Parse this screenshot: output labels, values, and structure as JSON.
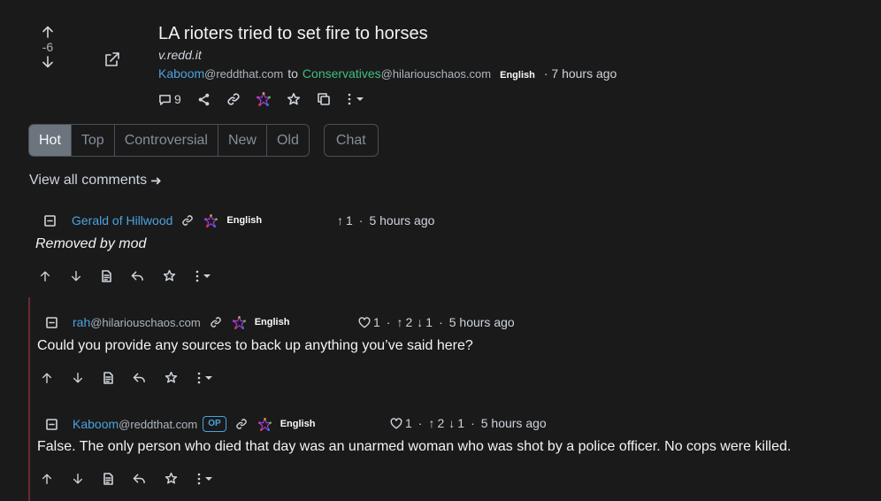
{
  "post": {
    "score": "-6",
    "title": "LA rioters tried to set fire to horses",
    "url": "v.redd.it",
    "author": "Kaboom",
    "author_domain": "@reddthat.com",
    "to_label": "to",
    "community": "Conservatives",
    "community_domain": "@hilariouschaos.com",
    "language": "English",
    "time": "· 7 hours ago",
    "comment_count": "9",
    "icons": [
      "arrow-up-icon",
      "arrow-down-icon",
      "external-link-icon",
      "comment-icon",
      "share-icon",
      "link-icon",
      "fediverse-icon",
      "star-icon",
      "copy-icon",
      "more-icon",
      "caret-down-icon"
    ]
  },
  "sort": {
    "tabs": [
      "Hot",
      "Top",
      "Controversial",
      "New",
      "Old"
    ],
    "active": "Hot",
    "chat_label": "Chat"
  },
  "view_all": {
    "label": "View all comments",
    "arrow": "➜"
  },
  "comments": [
    {
      "author": "Gerald of Hillwood",
      "domain": "",
      "language": "English",
      "score_up": "1",
      "time": "5 hours ago",
      "body": "Removed by mod"
    },
    {
      "author": "rah",
      "domain": "@hilariouschaos.com",
      "language": "English",
      "likes": "1",
      "up": "2",
      "down": "1",
      "time": "5 hours ago",
      "body": "Could you provide any sources to back up anything you’ve said here?"
    },
    {
      "author": "Kaboom",
      "domain": "@reddthat.com",
      "op_badge": "OP",
      "language": "English",
      "likes": "1",
      "up": "2",
      "down": "1",
      "time": "5 hours ago",
      "body": "False. The only person who died that day was an unarmed woman who was shot by a police officer. No cops were killed."
    }
  ],
  "separators": {
    "dot": "·"
  },
  "colors": {
    "background": "#1a1a1b",
    "link": "#4aa3df",
    "community": "#3fbf7f",
    "thread_bar": "#6b2a2e",
    "active_tab": "#6c757d"
  }
}
